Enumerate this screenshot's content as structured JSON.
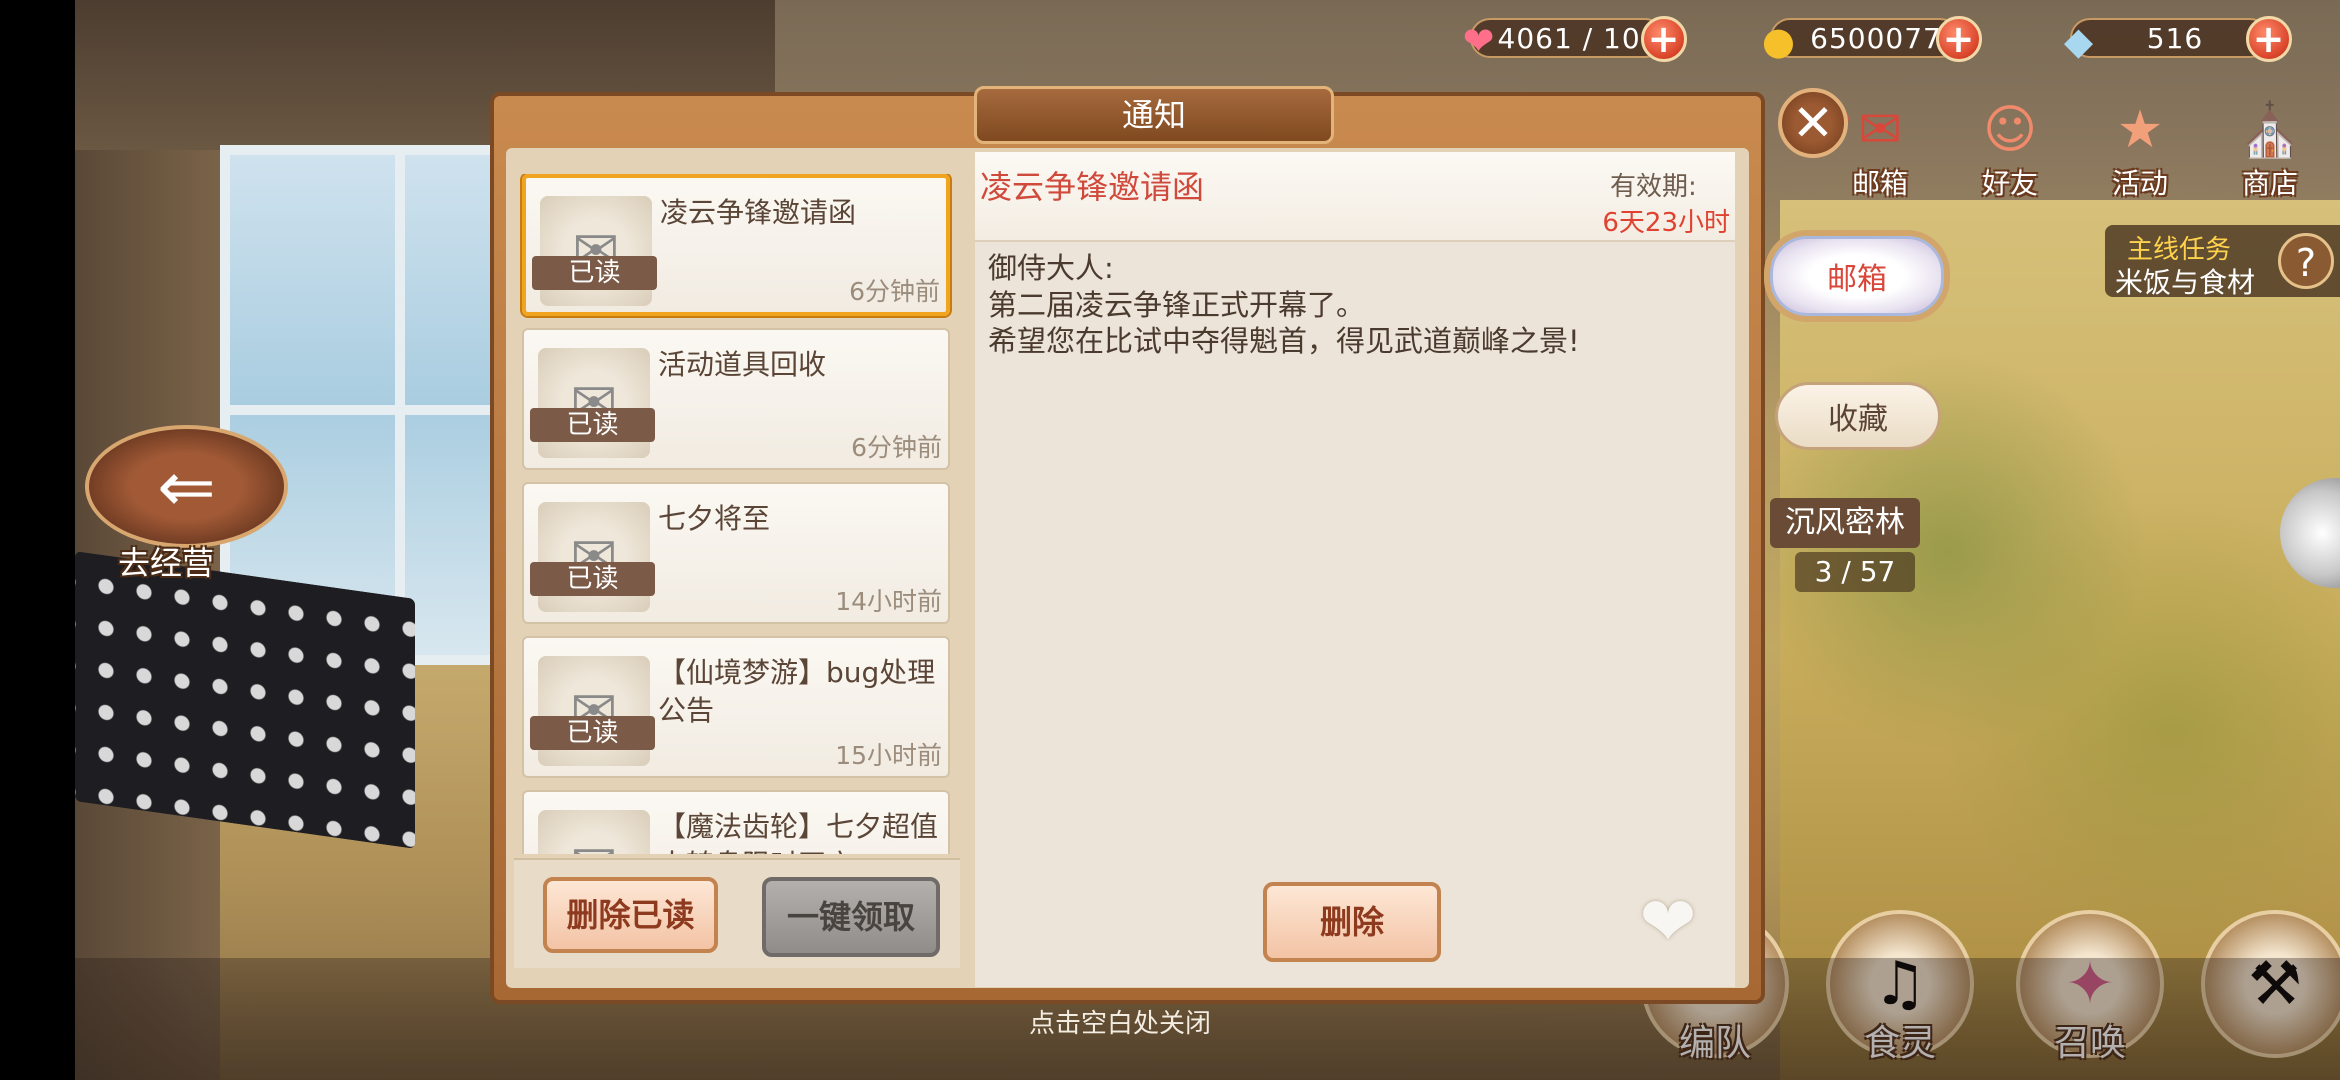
{
  "resources": {
    "stamina": "4061 / 100",
    "coins": "6500077",
    "gems": "516"
  },
  "top_menu": [
    {
      "label": "",
      "icon": "gift-icon"
    },
    {
      "label": "邮箱",
      "icon": "mail-icon"
    },
    {
      "label": "好友",
      "icon": "friends-icon"
    },
    {
      "label": "活动",
      "icon": "star-icon"
    },
    {
      "label": "商店",
      "icon": "shop-icon"
    }
  ],
  "quest": {
    "title": "主线任务",
    "subtitle": "米饭与食材"
  },
  "side_tabs": {
    "mailbox": "邮箱",
    "favorites": "收藏"
  },
  "stage": {
    "name": "沉风密林",
    "progress": "3 / 57"
  },
  "left_nav": {
    "label": "去经营"
  },
  "bottom_nav": [
    {
      "label": "编队"
    },
    {
      "label": "食灵"
    },
    {
      "label": "召唤"
    },
    {
      "label": ""
    }
  ],
  "dialog": {
    "title": "通知",
    "mails": [
      {
        "subject": "凌云争锋邀请函",
        "status": "已读",
        "time": "6分钟前",
        "selected": true
      },
      {
        "subject": "活动道具回收",
        "status": "已读",
        "time": "6分钟前"
      },
      {
        "subject": "七夕将至",
        "status": "已读",
        "time": "14小时前"
      },
      {
        "subject": "【仙境梦游】bug处理公告",
        "status": "已读",
        "time": "15小时前"
      },
      {
        "subject": "【魔法齿轮】七夕超值大转盘限时开启!",
        "status": "",
        "time": ""
      }
    ],
    "delete_read": "删除已读",
    "claim_all": "一键领取",
    "detail": {
      "title": "凌云争锋邀请函",
      "valid_label": "有效期:",
      "valid_value": "6天23小时",
      "lines": [
        "御侍大人:",
        "第二届凌云争锋正式开幕了。",
        "希望您在比试中夺得魁首，得见武道巅峰之景!"
      ]
    },
    "delete": "删除"
  },
  "close_hint": "点击空白处关闭"
}
